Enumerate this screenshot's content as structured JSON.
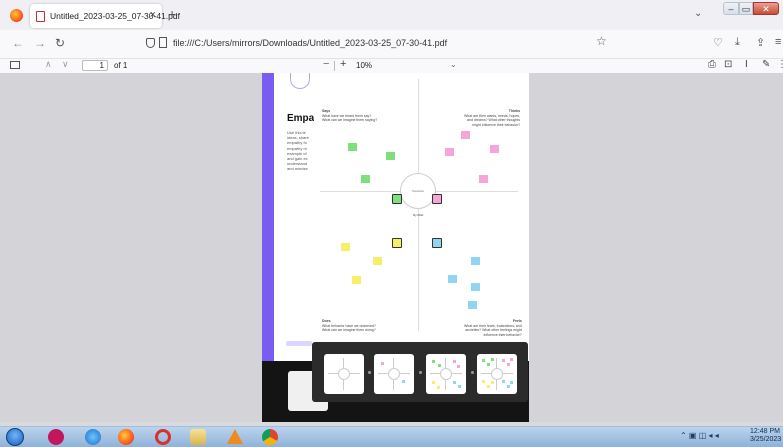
{
  "browser": {
    "tab": {
      "title": "Untitled_2023-03-25_07-30-41.pdf"
    },
    "url": "file:///C:/Users/mirrors/Downloads/Untitled_2023-03-25_07-30-41.pdf"
  },
  "pdf_toolbar": {
    "page_number": "1",
    "page_count_label": "of 1",
    "zoom_value": "10%"
  },
  "document": {
    "title": "Empa",
    "intro_text": "Use this te\nideas, share\nempathy fo\nempathy m\nexample of\nand gain ex\nunderstand\nand mindse",
    "map": {
      "center_label": "Persona",
      "quadrants": [
        {
          "heading": "Says",
          "subtext": "What have we heard them say?\nWhat can we imagine them saying?"
        },
        {
          "heading": "Thinks",
          "subtext": "What are their wants, needs, hopes,\nand dreams? What other thoughts\nmight influence their behavior?"
        },
        {
          "heading": "Does",
          "subtext": "What behavior have we observed?\nWhat can we imagine them doing?"
        },
        {
          "heading": "Feels",
          "subtext": "What are their fears, frustrations, and\nanxieties? What other feelings might\ninfluence their behavior?"
        }
      ],
      "below_center_label": "Dy Mob",
      "colors": {
        "green": "#7ee07a",
        "pink": "#f4a6d8",
        "yellow": "#f5ef6a",
        "blue": "#8fd6ee"
      }
    }
  },
  "taskbar": {
    "clock_time": "12:48 PM",
    "clock_date": "3/25/2023"
  }
}
